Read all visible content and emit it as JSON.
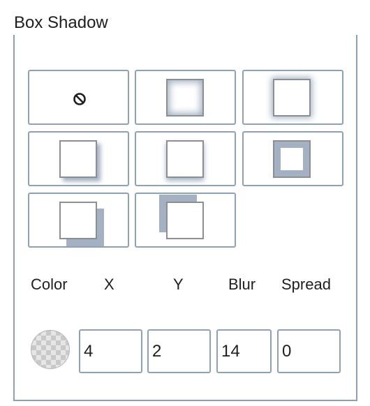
{
  "panel": {
    "title": "Box Shadow"
  },
  "presets": [
    {
      "name": "none",
      "icon": "no-entry-icon"
    },
    {
      "name": "inset-glow"
    },
    {
      "name": "outer-glow"
    },
    {
      "name": "drop-bottom-right"
    },
    {
      "name": "soft-bottom"
    },
    {
      "name": "inset-border"
    },
    {
      "name": "hard-bottom-right"
    },
    {
      "name": "hard-top-left"
    }
  ],
  "fields": {
    "color_label": "Color",
    "x_label": "X",
    "y_label": "Y",
    "blur_label": "Blur",
    "spread_label": "Spread",
    "x_value": "4",
    "y_value": "2",
    "blur_value": "14",
    "spread_value": "0"
  },
  "colors": {
    "border": "#8da2b5",
    "shadow": "#a4b1c2",
    "text": "#1e1e1e"
  }
}
